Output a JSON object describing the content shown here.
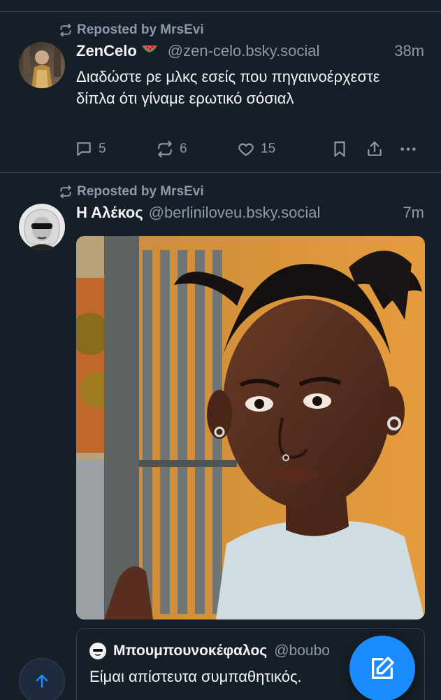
{
  "colors": {
    "background": "#161e27",
    "divider": "#2e4052",
    "text_primary": "#f1f3f5",
    "text_secondary": "#8c9aab",
    "accent": "#1a8cff"
  },
  "posts": [
    {
      "repost_label": "Reposted by MrsEvi",
      "author_name": "ZenCelo",
      "author_emoji": "watermelon",
      "handle": "@zen-celo.bsky.social",
      "time": "38m",
      "text": "Διαδώστε ρε μλκς εσείς που πηγαινοέρχεστε δίπλα ότι γίναμε ερωτικό σόσιαλ",
      "replies": "5",
      "reposts": "6",
      "likes": "15"
    },
    {
      "repost_label": "Reposted by MrsEvi",
      "author_name": "Η Αλέκος",
      "handle": "@berliniloveu.bsky.social",
      "time": "7m",
      "quote": {
        "author_name": "Μπουμπουνοκέφαλος",
        "handle": "@boubo",
        "text": "Είμαι απίστευτα συμπαθητικός."
      }
    }
  ],
  "icons": {
    "repost": "repost-icon",
    "reply": "reply-icon",
    "like": "heart-icon",
    "bookmark": "bookmark-icon",
    "share": "share-icon",
    "more": "more-icon",
    "scroll_top": "arrow-up-icon",
    "compose": "compose-icon"
  }
}
